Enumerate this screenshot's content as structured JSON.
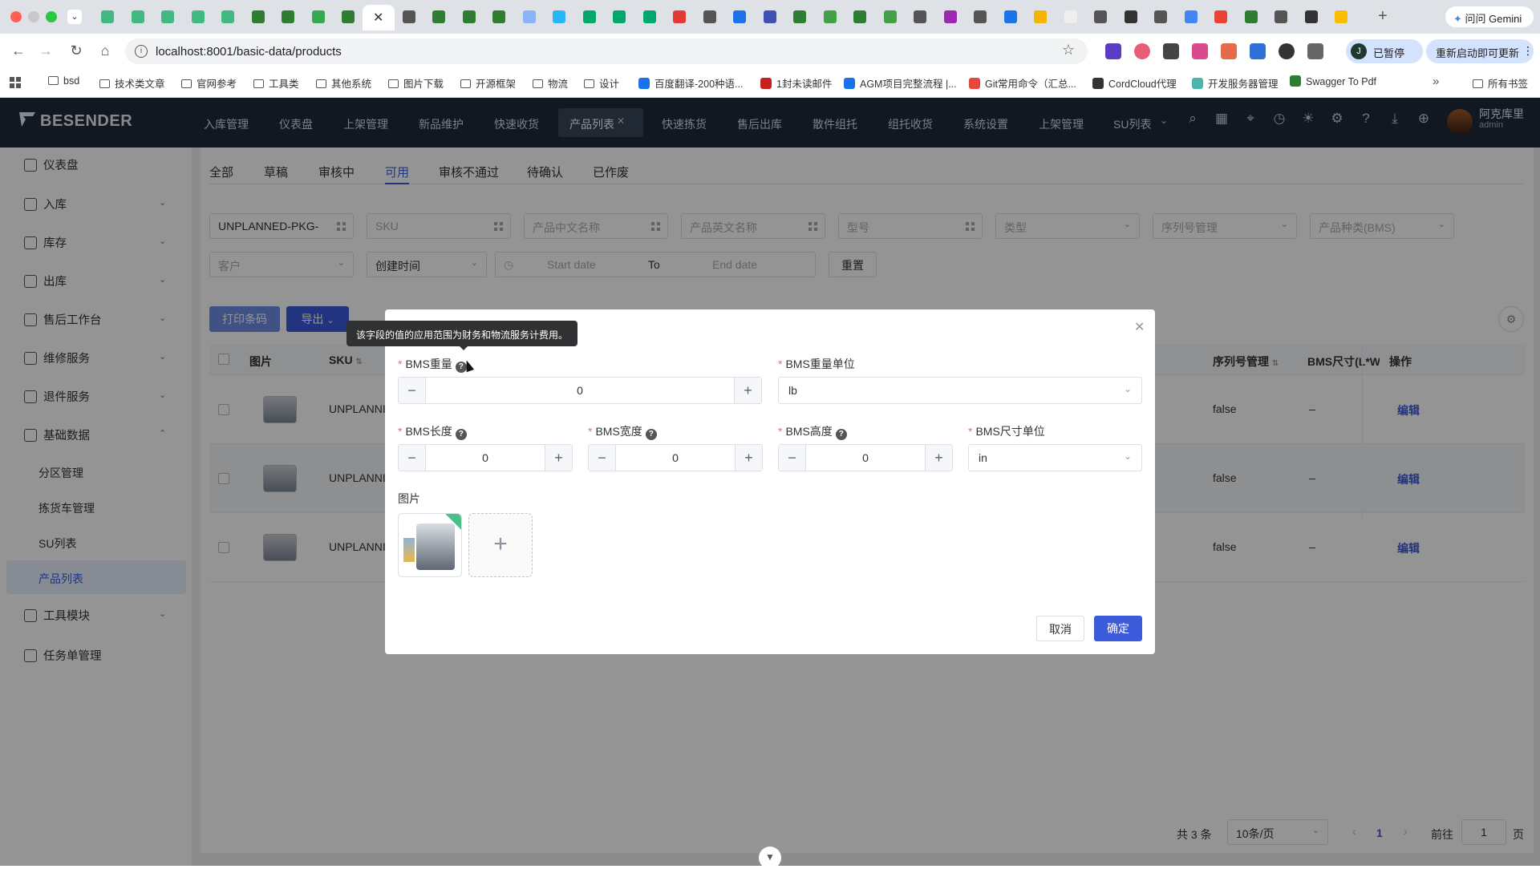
{
  "browser": {
    "url": "localhost:8001/basic-data/products",
    "paused_label": "已暂停",
    "paused_avatar": "J",
    "restart_label": "重新启动即可更新",
    "gemini_label": "问问 Gemini",
    "bookmarks": [
      "bsd",
      "技术类文章",
      "官网参考",
      "工具类",
      "其他系统",
      "图片下载",
      "开源框架",
      "物流",
      "设计",
      "百度翻译-200种语...",
      "1封未读邮件",
      "AGM项目完整流程 |...",
      "Git常用命令（汇总...",
      "CordCloud代理",
      "开发服务器管理",
      "Swagger To Pdf"
    ],
    "all_bookmarks": "所有书签"
  },
  "app": {
    "logo": "BESENDER",
    "menu": [
      "入库管理",
      "仪表盘",
      "上架管理",
      "新品维护",
      "快速收货",
      "产品列表",
      "快速拣货",
      "售后出库",
      "散件组托",
      "组托收货",
      "系统设置",
      "上架管理",
      "SU列表"
    ],
    "user_name": "阿克库里",
    "user_role": "admin"
  },
  "sidebar": {
    "items": [
      {
        "label": "仪表盘"
      },
      {
        "label": "入库"
      },
      {
        "label": "库存"
      },
      {
        "label": "出库"
      },
      {
        "label": "售后工作台"
      },
      {
        "label": "维修服务"
      },
      {
        "label": "退件服务"
      },
      {
        "label": "基础数据"
      },
      {
        "label": "工具模块"
      },
      {
        "label": "任务单管理"
      }
    ],
    "sub_items": [
      "分区管理",
      "拣货车管理",
      "SU列表",
      "产品列表"
    ]
  },
  "status_tabs": [
    "全部",
    "草稿",
    "审核中",
    "可用",
    "审核不通过",
    "待确认",
    "已作废"
  ],
  "filters": {
    "sku_value": "UNPLANNED-PKG-",
    "sku_placeholder": "SKU",
    "cn_name": "产品中文名称",
    "en_name": "产品英文名称",
    "model": "型号",
    "type": "类型",
    "serial_mgmt": "序列号管理",
    "category": "产品种类(BMS)",
    "customer": "客户",
    "created_time": "创建时间",
    "start_date": "Start date",
    "to": "To",
    "end_date": "End date",
    "reset": "重置"
  },
  "actions": {
    "print_barcode": "打印条码",
    "export": "导出"
  },
  "table": {
    "headers": {
      "image": "图片",
      "sku": "SKU",
      "serial": "序列号管理",
      "bms_size": "BMS尺寸(L*W",
      "ops": "操作"
    },
    "rows": [
      {
        "sku": "UNPLANNI",
        "serial": "false",
        "bms": "–",
        "op": "编辑"
      },
      {
        "sku": "UNPLANNI",
        "serial": "false",
        "bms": "–",
        "op": "编辑"
      },
      {
        "sku": "UNPLANNI",
        "serial": "false",
        "bms": "–",
        "op": "编辑"
      }
    ]
  },
  "pagination": {
    "total": "共 3 条",
    "page_size": "10条/页",
    "current": "1",
    "goto": "前往",
    "goto_value": "1",
    "page_suffix": "页"
  },
  "dialog": {
    "tooltip": "该字段的值的应用范围为财务和物流服务计费用。",
    "weight_label": "BMS重量",
    "weight_value": "0",
    "weight_unit_label": "BMS重量单位",
    "weight_unit_value": "lb",
    "length_label": "BMS长度",
    "length_value": "0",
    "width_label": "BMS宽度",
    "width_value": "0",
    "height_label": "BMS高度",
    "height_value": "0",
    "size_unit_label": "BMS尺寸单位",
    "size_unit_value": "in",
    "image_label": "图片",
    "cancel": "取消",
    "confirm": "确定"
  },
  "colors": {
    "primary": "#3b5bdb",
    "header_bg": "#1e2a3c",
    "required": "#f56c6c"
  }
}
